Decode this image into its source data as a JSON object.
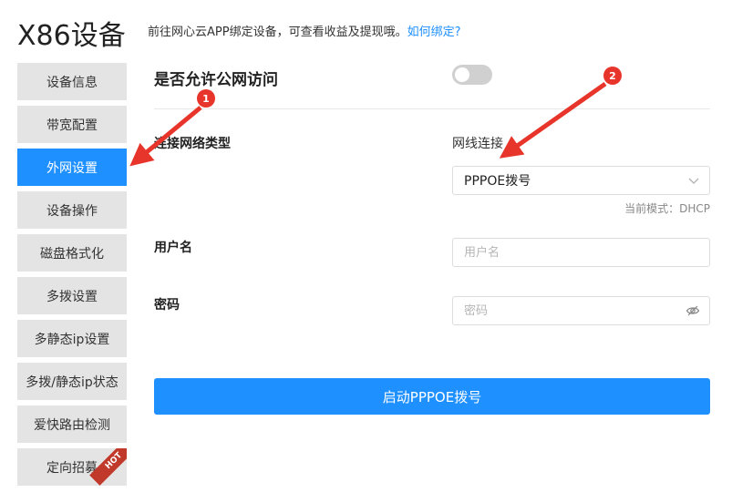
{
  "header": {
    "title": "X86设备",
    "hint_text": "前往网心云APP绑定设备，可查看收益及提现哦。",
    "hint_link": "如何绑定?"
  },
  "sidebar": {
    "items": [
      {
        "label": "设备信息",
        "active": false
      },
      {
        "label": "带宽配置",
        "active": false
      },
      {
        "label": "外网设置",
        "active": true
      },
      {
        "label": "设备操作",
        "active": false
      },
      {
        "label": "磁盘格式化",
        "active": false
      },
      {
        "label": "多拨设置",
        "active": false
      },
      {
        "label": "多静态ip设置",
        "active": false
      },
      {
        "label": "多拨/静态ip状态",
        "active": false
      },
      {
        "label": "爱快路由检测",
        "active": false
      },
      {
        "label": "定向招募",
        "active": false,
        "badge": "HOT"
      }
    ]
  },
  "form": {
    "public_access_label": "是否允许公网访问",
    "public_access_enabled": false,
    "conn_type_label": "连接网络类型",
    "wired_label": "网线连接",
    "conn_type_value": "PPPOE拨号",
    "current_mode": "当前模式：DHCP",
    "username_label": "用户名",
    "username_placeholder": "用户名",
    "password_label": "密码",
    "password_placeholder": "密码",
    "submit_label": "启动PPPOE拨号"
  },
  "annotations": {
    "badge_1": "1",
    "badge_2": "2"
  },
  "colors": {
    "accent": "#1e90ff",
    "annotation_red": "#e8352b",
    "hot_badge": "#c0392b"
  }
}
